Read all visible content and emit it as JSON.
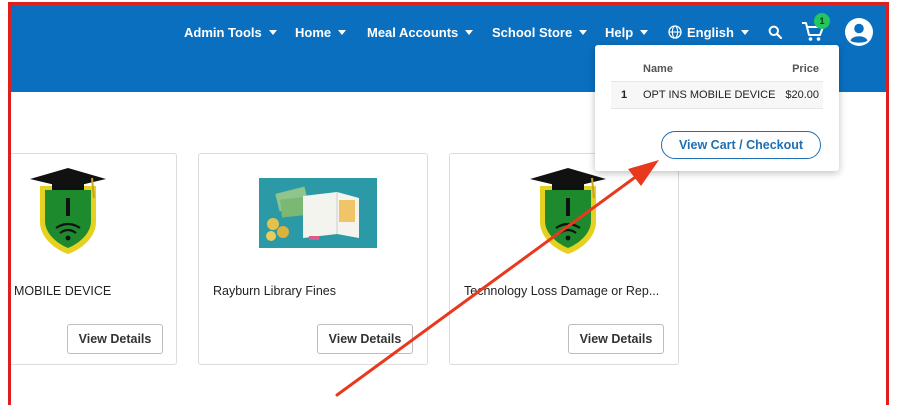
{
  "nav": {
    "admin_tools": "Admin Tools",
    "home": "Home",
    "meal_accounts": "Meal Accounts",
    "school_store": "School Store",
    "help": "Help",
    "language": "English"
  },
  "cart": {
    "badge_count": "1",
    "columns": {
      "name": "Name",
      "price": "Price"
    },
    "items": [
      {
        "qty": "1",
        "name": "OPT INS MOBILE DEVICE",
        "price": "$20.00"
      }
    ],
    "checkout_label": "View Cart / Checkout"
  },
  "products": [
    {
      "title": "MOBILE DEVICE",
      "button": "View Details"
    },
    {
      "title": "Rayburn Library Fines",
      "button": "View Details"
    },
    {
      "title": "Technology Loss Damage or Rep...",
      "button": "View Details"
    }
  ],
  "colors": {
    "brand": "#0a6fbf",
    "highlight_frame": "#e01e1e",
    "annotation_arrow": "#e8391f",
    "badge": "#22c55e",
    "checkout_accent": "#1f6fb5"
  },
  "icons": {
    "language": "globe-icon",
    "search": "search-icon",
    "cart": "cart-icon",
    "account": "user-avatar-icon"
  }
}
